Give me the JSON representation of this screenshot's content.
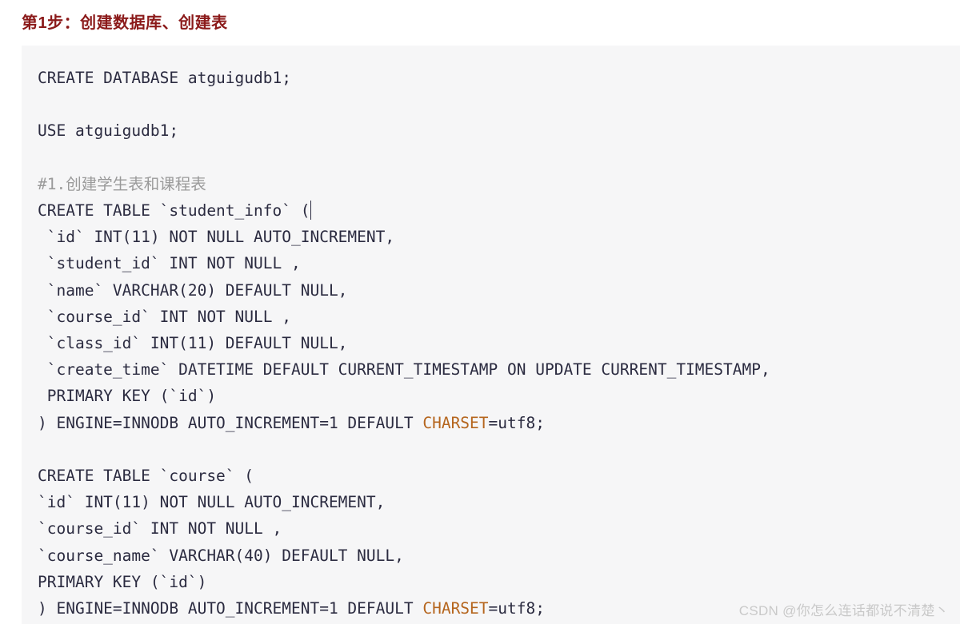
{
  "heading": {
    "text": "第1步：创建数据库、创建表",
    "color": "#8b1a1a"
  },
  "code_block": {
    "background": "#f6f6f7",
    "text_color": "#2b2b40",
    "comment_color": "#9a9a9a",
    "highlight_color": "#b5651d",
    "language": "sql",
    "caret_visible": true,
    "lines": [
      {
        "text": "CREATE DATABASE atguigudb1;",
        "type": "code"
      },
      {
        "text": "",
        "type": "blank"
      },
      {
        "text": "USE atguigudb1;",
        "type": "code"
      },
      {
        "text": "",
        "type": "blank"
      },
      {
        "text": "#1.创建学生表和课程表",
        "type": "comment"
      },
      {
        "text": "CREATE TABLE `student_info` (",
        "type": "code",
        "caret_after": true
      },
      {
        "text": " `id` INT(11) NOT NULL AUTO_INCREMENT,",
        "type": "code"
      },
      {
        "text": " `student_id` INT NOT NULL ,",
        "type": "code"
      },
      {
        "text": " `name` VARCHAR(20) DEFAULT NULL,",
        "type": "code"
      },
      {
        "text": " `course_id` INT NOT NULL ,",
        "type": "code"
      },
      {
        "text": " `class_id` INT(11) DEFAULT NULL,",
        "type": "code"
      },
      {
        "text": " `create_time` DATETIME DEFAULT CURRENT_TIMESTAMP ON UPDATE CURRENT_TIMESTAMP,",
        "type": "code"
      },
      {
        "text": " PRIMARY KEY (`id`)",
        "type": "code"
      },
      {
        "prefix": ") ENGINE=INNODB AUTO_INCREMENT=1 DEFAULT ",
        "highlight": "CHARSET",
        "suffix": "=utf8;",
        "type": "code-highlight"
      },
      {
        "text": "",
        "type": "blank"
      },
      {
        "text": "CREATE TABLE `course` (",
        "type": "code"
      },
      {
        "text": "`id` INT(11) NOT NULL AUTO_INCREMENT,",
        "type": "code"
      },
      {
        "text": "`course_id` INT NOT NULL ,",
        "type": "code"
      },
      {
        "text": "`course_name` VARCHAR(40) DEFAULT NULL,",
        "type": "code"
      },
      {
        "text": "PRIMARY KEY (`id`)",
        "type": "code"
      },
      {
        "prefix": ") ENGINE=INNODB AUTO_INCREMENT=1 DEFAULT ",
        "highlight": "CHARSET",
        "suffix": "=utf8;",
        "type": "code-highlight"
      }
    ]
  },
  "watermark": {
    "text": "CSDN @你怎么连话都说不清楚丶"
  }
}
